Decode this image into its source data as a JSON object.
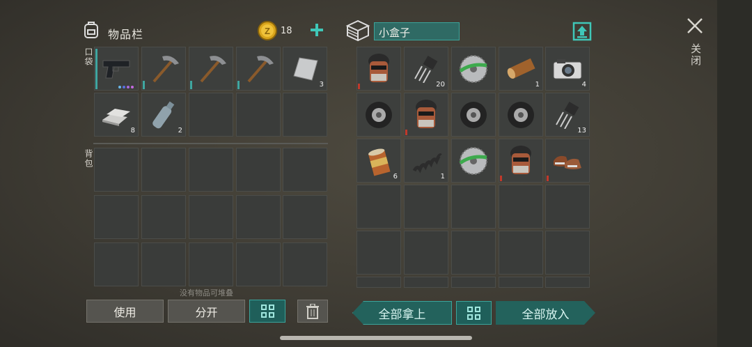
{
  "inventory": {
    "title": "物品栏",
    "coins": "18",
    "pocket_label": "口袋",
    "backpack_label": "背包",
    "no_stack_text": "没有物品可堆叠",
    "pocket_items": [
      {
        "name": "pistol",
        "count": ""
      },
      {
        "name": "pickaxe",
        "count": ""
      },
      {
        "name": "pickaxe",
        "count": ""
      },
      {
        "name": "pickaxe",
        "count": ""
      },
      {
        "name": "metal-plate",
        "count": "3"
      },
      {
        "name": "iron-bars",
        "count": "8"
      },
      {
        "name": "water-bottle",
        "count": "2"
      }
    ]
  },
  "container": {
    "title": "小盒子",
    "items": [
      {
        "name": "welding-mask",
        "count": ""
      },
      {
        "name": "transistor",
        "count": "20"
      },
      {
        "name": "saw-blade",
        "count": ""
      },
      {
        "name": "log",
        "count": "1"
      },
      {
        "name": "camera",
        "count": "4"
      },
      {
        "name": "tire",
        "count": ""
      },
      {
        "name": "welding-mask",
        "count": ""
      },
      {
        "name": "tire",
        "count": ""
      },
      {
        "name": "tire",
        "count": ""
      },
      {
        "name": "transistor",
        "count": "13"
      },
      {
        "name": "tin-can",
        "count": "6"
      },
      {
        "name": "spring",
        "count": "1"
      },
      {
        "name": "saw-blade",
        "count": ""
      },
      {
        "name": "welding-mask",
        "count": ""
      },
      {
        "name": "boots",
        "count": ""
      }
    ]
  },
  "buttons": {
    "use": "使用",
    "split": "分开",
    "take_all": "全部拿上",
    "put_all": "全部放入"
  },
  "close_label": "关闭",
  "colors": {
    "accent": "#3aa59c",
    "background": "#45423a"
  }
}
